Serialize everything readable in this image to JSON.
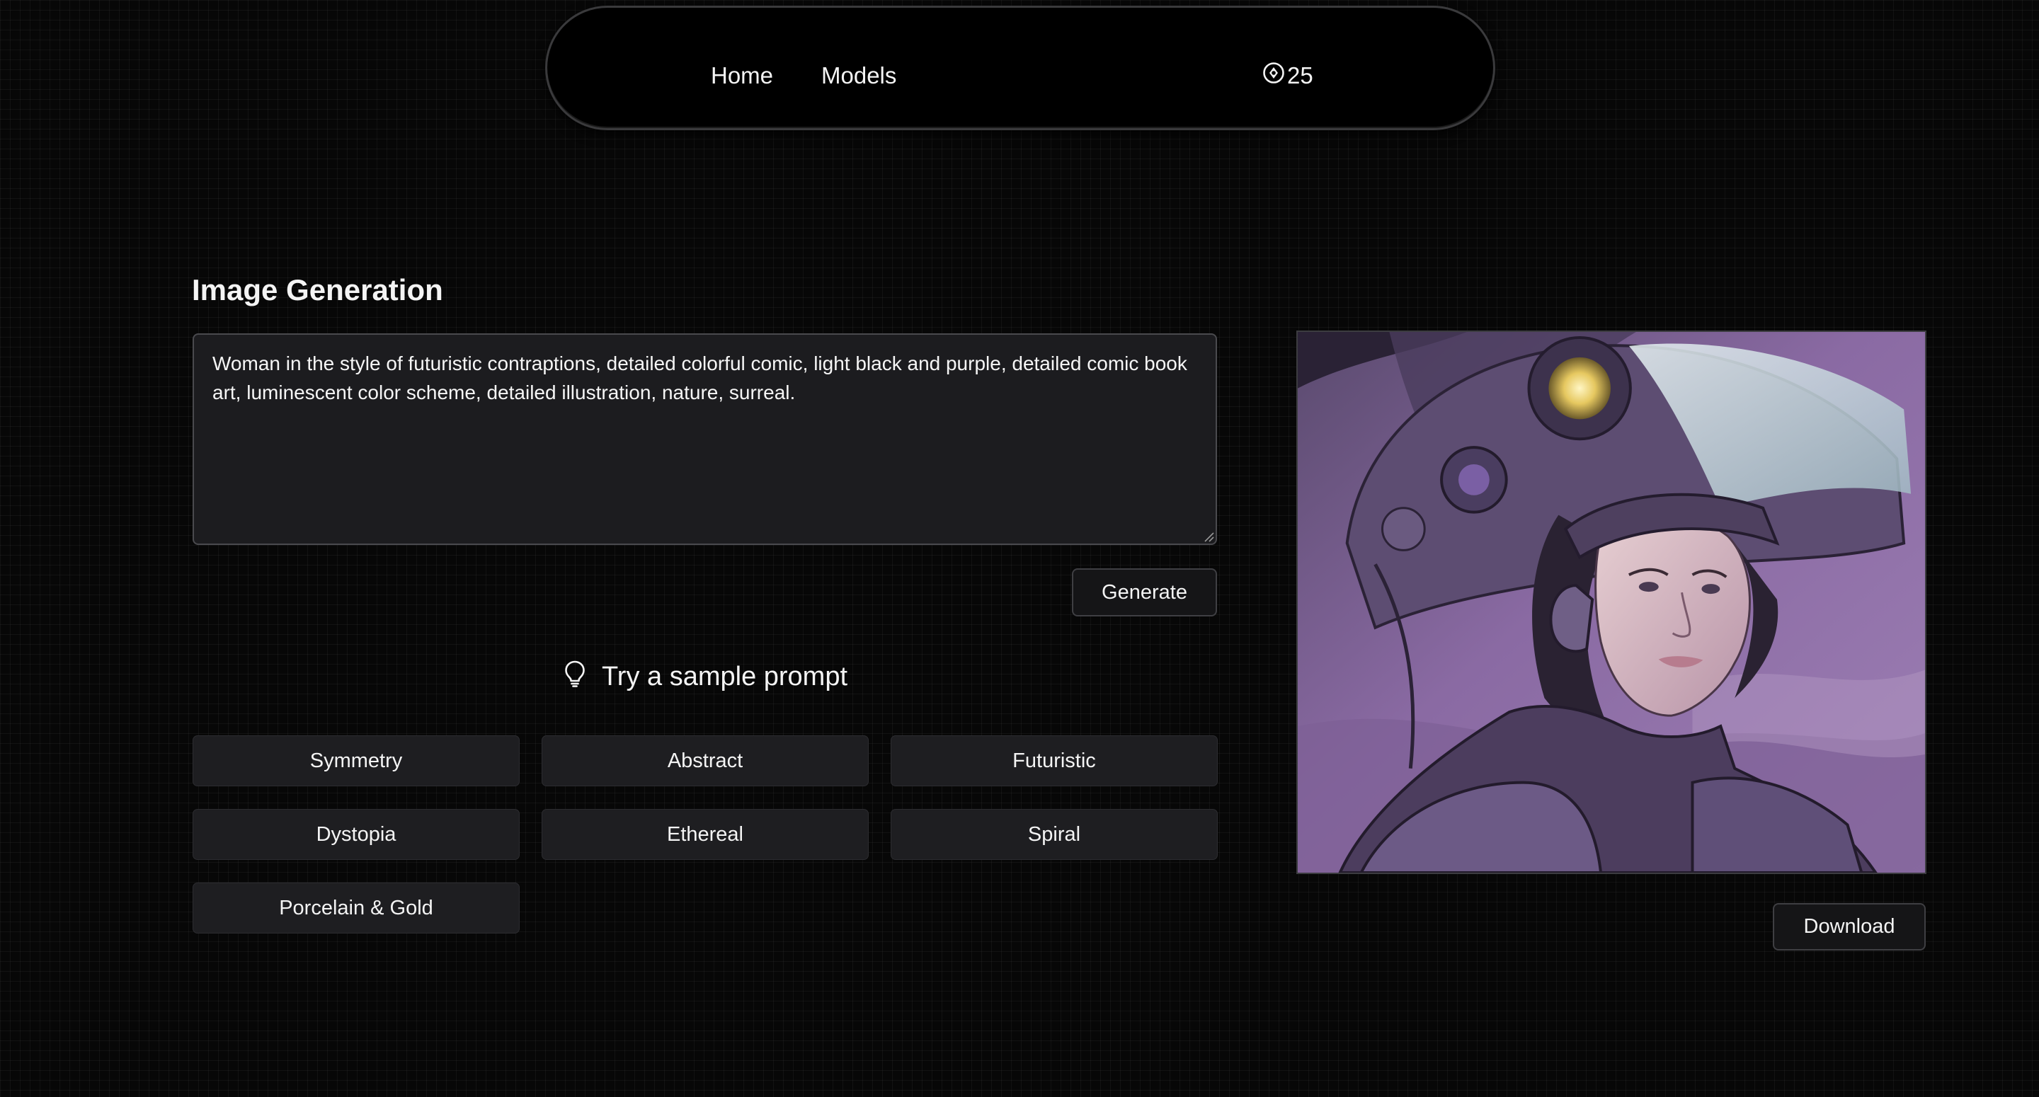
{
  "nav": {
    "home_label": "Home",
    "models_label": "Models",
    "credits_value": "25",
    "credits_icon": "coin-icon"
  },
  "generation": {
    "title": "Image Generation",
    "prompt_text": "Woman in the style of futuristic contraptions, detailed colorful comic, light black and purple, detailed comic book art, luminescent color scheme, detailed illustration, nature, surreal.",
    "generate_label": "Generate"
  },
  "samples": {
    "heading": "Try a sample prompt",
    "heading_icon": "lightbulb-icon",
    "chips": [
      "Symmetry",
      "Abstract",
      "Futuristic",
      "Dystopia",
      "Ethereal",
      "Spiral",
      "Porcelain & Gold"
    ]
  },
  "result": {
    "download_label": "Download"
  },
  "colors": {
    "background": "#070707",
    "panel": "#1c1c1f",
    "image_accent": "#8a6aa3"
  }
}
